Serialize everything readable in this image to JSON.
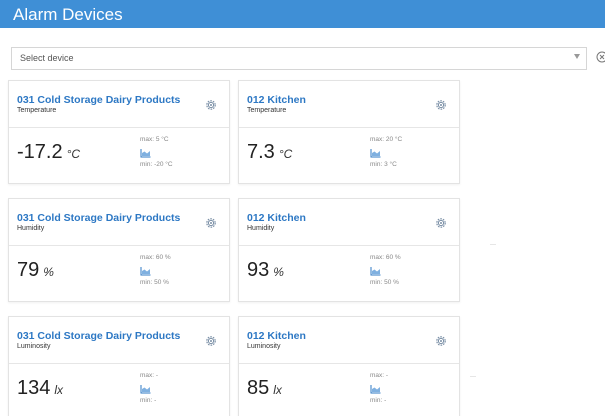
{
  "header": {
    "title": "Alarm Devices",
    "color": "#3f8fd6"
  },
  "device_select": {
    "placeholder": "Select device",
    "arrow_icon": "caret-down-icon",
    "clear_icon": "circle-x-icon"
  },
  "cards": [
    {
      "title": "031 Cold Storage Dairy Products",
      "sensor": "Temperature",
      "value": "-17.2",
      "unit": "°C",
      "max": "max: 5 °C",
      "min": "min: -20 °C"
    },
    {
      "title": "012 Kitchen",
      "sensor": "Temperature",
      "value": "7.3",
      "unit": "°C",
      "max": "max: 20 °C",
      "min": "min: 3 °C"
    },
    {
      "title": "031 Cold Storage Dairy Products",
      "sensor": "Humidity",
      "value": "79",
      "unit": "%",
      "max": "max: 60 %",
      "min": "min: 50 %"
    },
    {
      "title": "012 Kitchen",
      "sensor": "Humidity",
      "value": "93",
      "unit": "%",
      "max": "max: 60 %",
      "min": "min: 50 %"
    },
    {
      "title": "031 Cold Storage Dairy Products",
      "sensor": "Luminosity",
      "value": "134",
      "unit": "lx",
      "max": "max: -",
      "min": "min: -"
    },
    {
      "title": "012 Kitchen",
      "sensor": "Luminosity",
      "value": "85",
      "unit": "lx",
      "max": "max: -",
      "min": "min: -"
    }
  ]
}
